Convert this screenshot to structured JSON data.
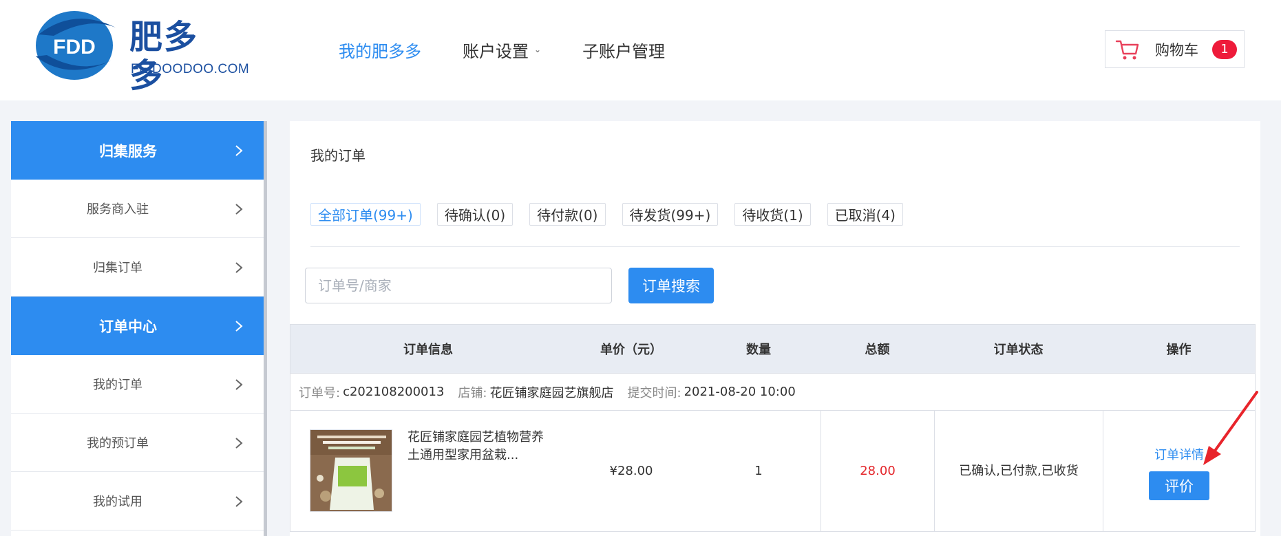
{
  "header": {
    "logo_mark": "FDD",
    "logo_cn": "肥多多",
    "logo_en": "FEIDOODOO.COM",
    "nav": [
      {
        "label": "我的肥多多",
        "active": true
      },
      {
        "label": "账户设置",
        "dropdown": true
      },
      {
        "label": "子账户管理"
      }
    ],
    "dropdown_caret": "⌄",
    "cart_label": "购物车",
    "cart_count": "1"
  },
  "sidebar": {
    "items": [
      {
        "label": "归集服务",
        "section": true
      },
      {
        "label": "服务商入驻"
      },
      {
        "label": "归集订单"
      },
      {
        "label": "订单中心",
        "section": true
      },
      {
        "label": "我的订单"
      },
      {
        "label": "我的预订单"
      },
      {
        "label": "我的试用"
      }
    ]
  },
  "main": {
    "title": "我的订单",
    "filters": [
      {
        "label": "全部订单(99+)",
        "active": true
      },
      {
        "label": "待确认(0)"
      },
      {
        "label": "待付款(0)"
      },
      {
        "label": "待发货(99+)"
      },
      {
        "label": "待收货(1)"
      },
      {
        "label": "已取消(4)"
      }
    ],
    "search_placeholder": "订单号/商家",
    "search_button": "订单搜索",
    "table": {
      "headers": [
        "订单信息",
        "单价（元）",
        "数量",
        "总额",
        "订单状态",
        "操作"
      ],
      "order": {
        "order_no_label": "订单号:",
        "order_no": "c202108200013",
        "store_label": "店铺:",
        "store": "花匠铺家庭园艺旗舰店",
        "time_label": "提交时间:",
        "time": "2021-08-20 10:00",
        "product_name": "花匠铺家庭园艺植物营养土通用型家用盆栽...",
        "unit_price": "¥28.00",
        "quantity": "1",
        "total": "28.00",
        "status": "已确认,已付款,已收货",
        "detail_link": "订单详情",
        "review_button": "评价"
      }
    }
  },
  "colors": {
    "accent": "#2d8cf0",
    "badge": "#ee1b3a",
    "total": "#e4262b",
    "annotation_arrow": "#e8242b"
  }
}
